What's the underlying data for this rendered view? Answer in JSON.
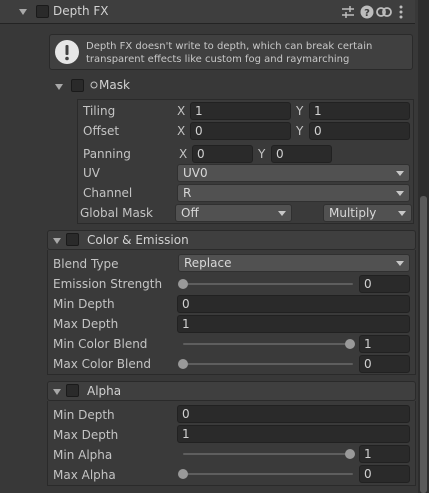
{
  "header": {
    "title": "Depth FX",
    "icons": [
      "sliders-icon",
      "help-icon",
      "link-icon",
      "more-icon"
    ]
  },
  "info": {
    "text_line1": "Depth FX doesn't write to depth, which can break certain",
    "text_line2": "transparent effects like custom fog and raymarching"
  },
  "mask": {
    "title": "Mask",
    "tiling_label": "Tiling",
    "tiling_x": "1",
    "tiling_y": "1",
    "offset_label": "Offset",
    "offset_x": "0",
    "offset_y": "0",
    "panning_label": "Panning",
    "panning_x": "0",
    "panning_y": "0",
    "x_label": "X",
    "y_label": "Y",
    "uv_label": "UV",
    "uv_value": "UV0",
    "channel_label": "Channel",
    "channel_value": "R",
    "global_mask_label": "Global Mask",
    "global_mask_value": "Off",
    "global_mask_mode": "Multiply"
  },
  "color_emission": {
    "title": "Color & Emission",
    "blend_type_label": "Blend Type",
    "blend_type_value": "Replace",
    "emission_strength_label": "Emission Strength",
    "emission_strength_value": "0",
    "emission_strength_level": 0.0,
    "min_depth_label": "Min Depth",
    "min_depth_value": "0",
    "max_depth_label": "Max Depth",
    "max_depth_value": "1",
    "min_color_blend_label": "Min Color Blend",
    "min_color_blend_value": "1",
    "min_color_blend_level": 1.0,
    "max_color_blend_label": "Max Color Blend",
    "max_color_blend_value": "0",
    "max_color_blend_level": 0.0
  },
  "alpha": {
    "title": "Alpha",
    "min_depth_label": "Min Depth",
    "min_depth_value": "0",
    "max_depth_label": "Max Depth",
    "max_depth_value": "1",
    "min_alpha_label": "Min Alpha",
    "min_alpha_value": "1",
    "min_alpha_level": 1.0,
    "max_alpha_label": "Max Alpha",
    "max_alpha_value": "0",
    "max_alpha_level": 0.0
  },
  "colors": {
    "background": "#383838",
    "field": "#2a2a2a",
    "dropdown": "#515151",
    "text": "#c4c4c4"
  }
}
